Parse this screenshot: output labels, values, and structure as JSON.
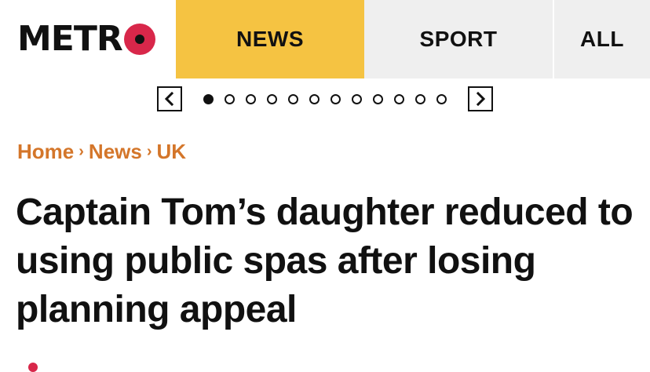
{
  "logo": {
    "text": "METR",
    "ring_color": "#d8274a"
  },
  "nav": {
    "tabs": [
      {
        "label": "NEWS",
        "active": true,
        "color": "#f5c342"
      },
      {
        "label": "SPORT",
        "active": false,
        "color": "#efefef"
      },
      {
        "label": "ALL",
        "active": false,
        "color": "#efefef"
      }
    ]
  },
  "carousel": {
    "prev_icon": "chevron-left-icon",
    "next_icon": "chevron-right-icon",
    "dot_count": 12,
    "active_index": 0
  },
  "breadcrumb": {
    "items": [
      "Home",
      "News",
      "UK"
    ],
    "color": "#d4762a"
  },
  "headline": "Captain Tom’s daughter reduced to using public spas after losing planning appeal"
}
